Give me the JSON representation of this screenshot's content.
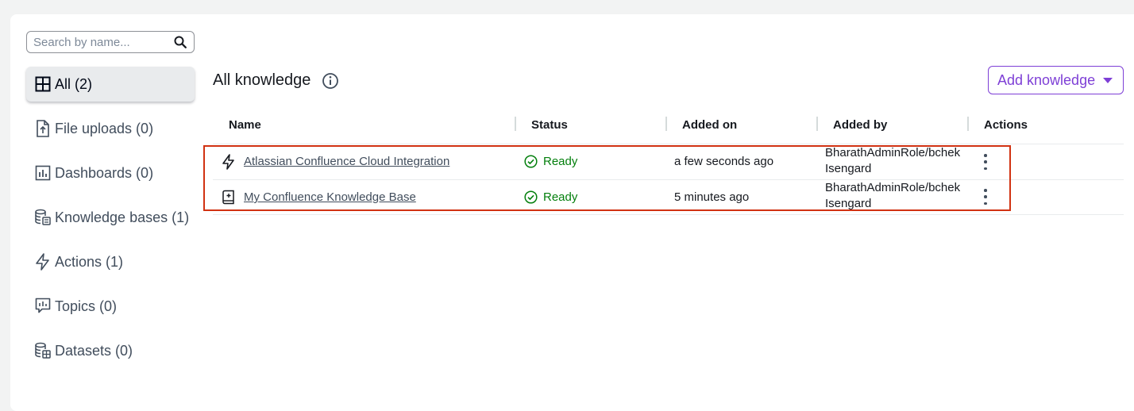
{
  "search": {
    "placeholder": "Search by name..."
  },
  "sidebar": {
    "items": [
      {
        "label": "All (2)",
        "icon": "grid-icon"
      },
      {
        "label": "File uploads (0)",
        "icon": "file-upload-icon"
      },
      {
        "label": "Dashboards (0)",
        "icon": "dashboard-icon"
      },
      {
        "label": "Knowledge bases (1)",
        "icon": "database-icon"
      },
      {
        "label": "Actions (1)",
        "icon": "lightning-icon"
      },
      {
        "label": "Topics (0)",
        "icon": "topic-icon"
      },
      {
        "label": "Datasets (0)",
        "icon": "dataset-icon"
      }
    ]
  },
  "header": {
    "title": "All knowledge",
    "add_button": "Add knowledge"
  },
  "table": {
    "columns": [
      "Name",
      "Status",
      "Added on",
      "Added by",
      "Actions"
    ],
    "rows": [
      {
        "icon": "lightning-icon",
        "name": "Atlassian Confluence Cloud Integration",
        "status": "Ready",
        "added_on": "a few seconds ago",
        "added_by": "BharathAdminRole/bchek Isengard"
      },
      {
        "icon": "knowledge-base-icon",
        "name": "My Confluence Knowledge Base",
        "status": "Ready",
        "added_on": "5 minutes ago",
        "added_by": "BharathAdminRole/bchek Isengard"
      }
    ]
  },
  "colors": {
    "accent": "#7e3fd6",
    "success": "#037f0c",
    "highlight": "#d13212"
  }
}
